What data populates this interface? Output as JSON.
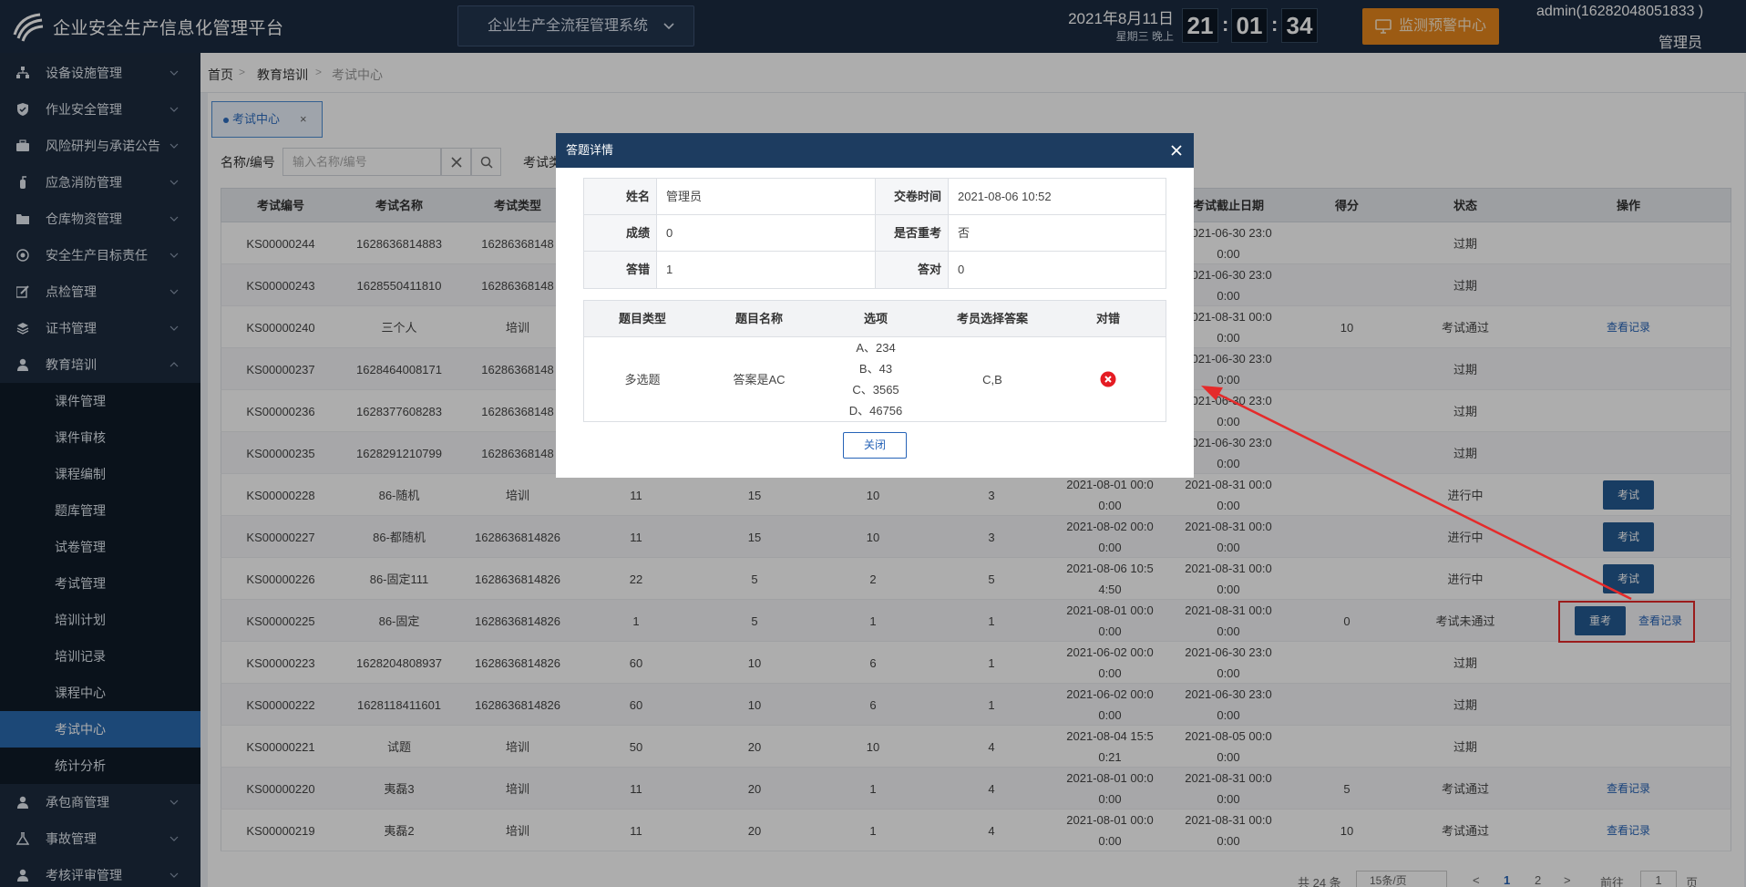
{
  "header": {
    "app_title": "企业安全生产信息化管理平台",
    "system_select": "企业生产全流程管理系统",
    "date": "2021年8月11日",
    "weekday": "星期三  晚上",
    "clock": {
      "h": "21",
      "m": "01",
      "s": "34"
    },
    "monitor_btn": "监测预警中心",
    "user": "admin(16282048051833 )",
    "role": "管理员"
  },
  "sidebar": {
    "items": [
      {
        "label": "设备设施管理",
        "icon": "sitemap-icon"
      },
      {
        "label": "作业安全管理",
        "icon": "shield-check-icon"
      },
      {
        "label": "风险研判与承诺公告",
        "icon": "briefcase-icon"
      },
      {
        "label": "应急消防管理",
        "icon": "fire-extinguisher-icon"
      },
      {
        "label": "仓库物资管理",
        "icon": "folder-icon"
      },
      {
        "label": "安全生产目标责任",
        "icon": "target-icon"
      },
      {
        "label": "点检管理",
        "icon": "edit-icon"
      },
      {
        "label": "证书管理",
        "icon": "layers-icon"
      },
      {
        "label": "教育培训",
        "icon": "user-icon"
      }
    ],
    "sub_items": [
      "课件管理",
      "课件审核",
      "课程编制",
      "题库管理",
      "试卷管理",
      "考试管理",
      "培训计划",
      "培训记录",
      "课程中心",
      "考试中心",
      "统计分析"
    ],
    "bottom_items": [
      {
        "label": "承包商管理",
        "icon": "user-icon"
      },
      {
        "label": "事故管理",
        "icon": "flask-icon"
      },
      {
        "label": "考核评审管理",
        "icon": "user-icon"
      }
    ]
  },
  "breadcrumb": [
    "首页",
    "教育培训",
    "考试中心"
  ],
  "tab": {
    "label": "考试中心",
    "close": "×"
  },
  "filter": {
    "name_label": "名称/编号",
    "name_placeholder": "输入名称/编号",
    "type_label": "考试类"
  },
  "table": {
    "headers": [
      "考试编号",
      "考试名称",
      "考试类型",
      "",
      "",
      "",
      "",
      "",
      "考试截止日期",
      "得分",
      "状态",
      "操作"
    ],
    "rows": [
      {
        "id": "KS00000244",
        "name": "1628636814883",
        "type": "16286368148",
        "c4": "",
        "c5": "",
        "c6": "",
        "c7": "",
        "start": "",
        "end": "2021-06-30 23:0\n0:00",
        "score": "",
        "status": "过期",
        "ops": []
      },
      {
        "id": "KS00000243",
        "name": "1628550411810",
        "type": "16286368148",
        "c4": "",
        "c5": "",
        "c6": "",
        "c7": "",
        "start": "",
        "end": "2021-06-30 23:0\n0:00",
        "score": "",
        "status": "过期",
        "ops": []
      },
      {
        "id": "KS00000240",
        "name": "三个人",
        "type": "培训",
        "c4": "",
        "c5": "",
        "c6": "",
        "c7": "",
        "start": "",
        "end": "2021-08-31 00:0\n0:00",
        "score": "10",
        "status": "考试通过",
        "ops": [
          "查看记录"
        ]
      },
      {
        "id": "KS00000237",
        "name": "1628464008171",
        "type": "16286368148",
        "c4": "",
        "c5": "",
        "c6": "",
        "c7": "",
        "start": "",
        "end": "2021-06-30 23:0\n0:00",
        "score": "",
        "status": "过期",
        "ops": []
      },
      {
        "id": "KS00000236",
        "name": "1628377608283",
        "type": "16286368148",
        "c4": "",
        "c5": "",
        "c6": "",
        "c7": "",
        "start": "",
        "end": "2021-06-30 23:0\n0:00",
        "score": "",
        "status": "过期",
        "ops": []
      },
      {
        "id": "KS00000235",
        "name": "1628291210799",
        "type": "16286368148",
        "c4": "",
        "c5": "",
        "c6": "",
        "c7": "",
        "start": "",
        "end": "2021-06-30 23:0\n0:00",
        "score": "",
        "status": "过期",
        "ops": []
      },
      {
        "id": "KS00000228",
        "name": "86-随机",
        "type": "培训",
        "c4": "11",
        "c5": "15",
        "c6": "10",
        "c7": "3",
        "start": "2021-08-01 00:0\n0:00",
        "end": "2021-08-31 00:0\n0:00",
        "score": "",
        "status": "进行中",
        "ops": [
          "考试"
        ]
      },
      {
        "id": "KS00000227",
        "name": "86-都随机",
        "type": "1628636814826",
        "c4": "11",
        "c5": "15",
        "c6": "10",
        "c7": "3",
        "start": "2021-08-02 00:0\n0:00",
        "end": "2021-08-31 00:0\n0:00",
        "score": "",
        "status": "进行中",
        "ops": [
          "考试"
        ]
      },
      {
        "id": "KS00000226",
        "name": "86-固定111",
        "type": "1628636814826",
        "c4": "22",
        "c5": "5",
        "c6": "2",
        "c7": "5",
        "start": "2021-08-06 10:5\n4:50",
        "end": "2021-08-31 00:0\n0:00",
        "score": "",
        "status": "进行中",
        "ops": [
          "考试"
        ]
      },
      {
        "id": "KS00000225",
        "name": "86-固定",
        "type": "1628636814826",
        "c4": "1",
        "c5": "5",
        "c6": "1",
        "c7": "1",
        "start": "2021-08-01 00:0\n0:00",
        "end": "2021-08-31 00:0\n0:00",
        "score": "0",
        "status": "考试未通过",
        "ops": [
          "重考",
          "查看记录"
        ]
      },
      {
        "id": "KS00000223",
        "name": "1628204808937",
        "type": "1628636814826",
        "c4": "60",
        "c5": "10",
        "c6": "6",
        "c7": "1",
        "start": "2021-06-02 00:0\n0:00",
        "end": "2021-06-30 23:0\n0:00",
        "score": "",
        "status": "过期",
        "ops": []
      },
      {
        "id": "KS00000222",
        "name": "1628118411601",
        "type": "1628636814826",
        "c4": "60",
        "c5": "10",
        "c6": "6",
        "c7": "1",
        "start": "2021-06-02 00:0\n0:00",
        "end": "2021-06-30 23:0\n0:00",
        "score": "",
        "status": "过期",
        "ops": []
      },
      {
        "id": "KS00000221",
        "name": "试题",
        "type": "培训",
        "c4": "50",
        "c5": "20",
        "c6": "10",
        "c7": "4",
        "start": "2021-08-04 15:5\n0:21",
        "end": "2021-08-05 00:0\n0:00",
        "score": "",
        "status": "过期",
        "ops": []
      },
      {
        "id": "KS00000220",
        "name": "夷磊3",
        "type": "培训",
        "c4": "11",
        "c5": "20",
        "c6": "1",
        "c7": "4",
        "start": "2021-08-01 00:0\n0:00",
        "end": "2021-08-31 00:0\n0:00",
        "score": "5",
        "status": "考试通过",
        "ops": [
          "查看记录"
        ]
      },
      {
        "id": "KS00000219",
        "name": "夷磊2",
        "type": "培训",
        "c4": "11",
        "c5": "20",
        "c6": "1",
        "c7": "4",
        "start": "2021-08-01 00:0\n0:00",
        "end": "2021-08-31 00:0\n0:00",
        "score": "10",
        "status": "考试通过",
        "ops": [
          "查看记录"
        ]
      }
    ]
  },
  "pager": {
    "total": "共 24 条",
    "size": "15条/页",
    "pages": [
      "1",
      "2"
    ],
    "goto_label": "前往",
    "goto_value": "1",
    "page_unit": "页"
  },
  "modal": {
    "title": "答题详情",
    "info": {
      "name_label": "姓名",
      "name": "管理员",
      "time_label": "交卷时间",
      "time": "2021-08-06 10:52",
      "score_label": "成绩",
      "score": "0",
      "retake_label": "是否重考",
      "retake": "否",
      "wrong_label": "答错",
      "wrong": "1",
      "right_label": "答对",
      "right": "0"
    },
    "answer_headers": [
      "题目类型",
      "题目名称",
      "选项",
      "考员选择答案",
      "对错"
    ],
    "answer_row": {
      "type": "多选题",
      "name": "答案是AC",
      "options": [
        "A、234",
        "B、43",
        "C、3565",
        "D、46756"
      ],
      "chosen": "C,B",
      "result_icon": "wrong-icon"
    },
    "close_btn": "关闭"
  },
  "colors": {
    "topbar": "#1b2b42",
    "sidebar": "#1c2b3e",
    "active": "#2a6ab0",
    "accent": "#245a92",
    "warning": "#e6861c",
    "annotation": "#e52a2a"
  }
}
